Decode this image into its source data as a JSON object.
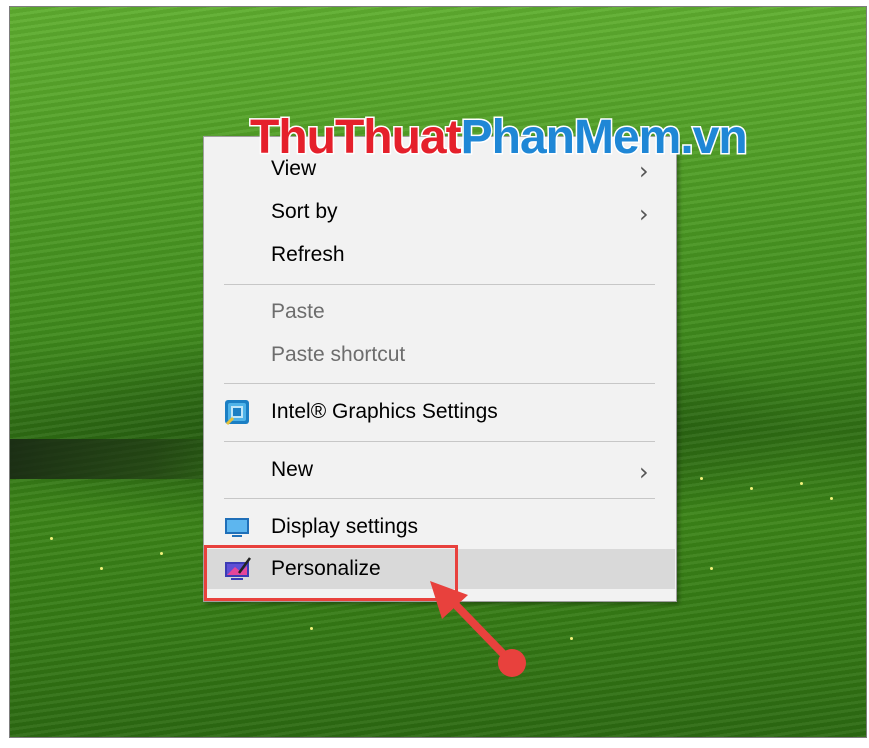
{
  "menu": {
    "items": [
      {
        "label": "View",
        "has_submenu": true,
        "disabled": false
      },
      {
        "label": "Sort by",
        "has_submenu": true,
        "disabled": false
      },
      {
        "label": "Refresh",
        "has_submenu": false,
        "disabled": false
      },
      {
        "label": "Paste",
        "has_submenu": false,
        "disabled": true
      },
      {
        "label": "Paste shortcut",
        "has_submenu": false,
        "disabled": true
      },
      {
        "label": "Intel® Graphics Settings",
        "icon": "intel-graphics-icon",
        "has_submenu": false,
        "disabled": false
      },
      {
        "label": "New",
        "has_submenu": true,
        "disabled": false
      },
      {
        "label": "Display settings",
        "icon": "display-icon",
        "has_submenu": false,
        "disabled": false
      },
      {
        "label": "Personalize",
        "icon": "personalize-icon",
        "has_submenu": false,
        "disabled": false,
        "highlighted": true
      }
    ]
  },
  "watermark": {
    "part1": "ThuThuat",
    "part2": "PhanMem",
    "part3": ".vn"
  },
  "colors": {
    "highlight": "#e8413d",
    "watermark_red": "#e5202b",
    "watermark_blue": "#1f87d6",
    "menu_bg": "#f2f2f2",
    "hover_bg": "#d9d9d9"
  }
}
